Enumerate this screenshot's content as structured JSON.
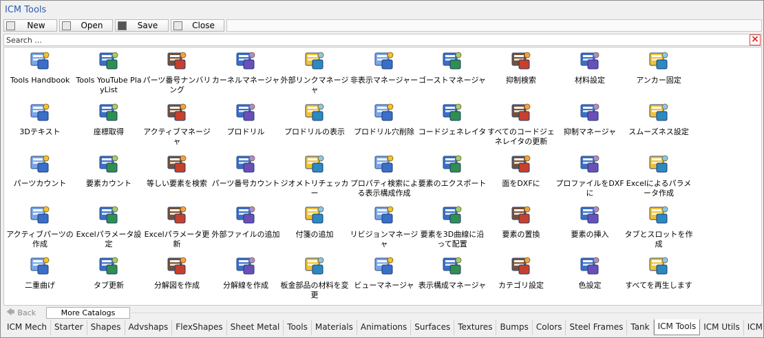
{
  "app": {
    "title": "ICM Tools"
  },
  "toolbar": {
    "new_label": "New",
    "open_label": "Open",
    "save_label": "Save",
    "close_label": "Close"
  },
  "search": {
    "placeholder": "Search ..."
  },
  "tools": [
    {
      "label": "Tools Handbook",
      "icon": "graduation-cap-icon"
    },
    {
      "label": "Tools YouTube PlayList",
      "icon": "video-playlist-icon"
    },
    {
      "label": "パーツ番号ナンバリング",
      "icon": "part-numbering-icon"
    },
    {
      "label": "カーネルマネージャ",
      "icon": "kernel-manager-icon"
    },
    {
      "label": "外部リンクマネージャ",
      "icon": "external-link-manager-icon"
    },
    {
      "label": "非表示マネージャー",
      "icon": "hide-manager-icon"
    },
    {
      "label": "ゴーストマネージャ",
      "icon": "ghost-manager-icon"
    },
    {
      "label": "抑制検索",
      "icon": "suppress-search-icon"
    },
    {
      "label": "材料設定",
      "icon": "material-setting-icon"
    },
    {
      "label": "アンカー固定",
      "icon": "anchor-fix-icon"
    },
    {
      "label": "3Dテキスト",
      "icon": "3d-text-icon"
    },
    {
      "label": "座標取得",
      "icon": "get-coordinates-icon"
    },
    {
      "label": "アクティブマネージャ",
      "icon": "active-manager-icon"
    },
    {
      "label": "プロドリル",
      "icon": "pro-drill-icon"
    },
    {
      "label": "プロドリルの表示",
      "icon": "pro-drill-show-icon"
    },
    {
      "label": "プロドリル穴削除",
      "icon": "pro-drill-delete-icon"
    },
    {
      "label": "コードジェネレイタ",
      "icon": "code-generator-icon"
    },
    {
      "label": "すべてのコードジェネレイタの更新",
      "icon": "code-generator-update-icon"
    },
    {
      "label": "抑制マネージャ",
      "icon": "suppress-manager-icon"
    },
    {
      "label": "スムーズネス設定",
      "icon": "smoothness-icon"
    },
    {
      "label": "パーツカウント",
      "icon": "parts-count-icon"
    },
    {
      "label": "要素カウント",
      "icon": "element-count-icon"
    },
    {
      "label": "等しい要素を検索",
      "icon": "find-equal-icon"
    },
    {
      "label": "パーツ番号カウント",
      "icon": "part-number-count-icon"
    },
    {
      "label": "ジオメトリチェッカー",
      "icon": "geometry-checker-icon"
    },
    {
      "label": "プロパティ検索による表示構成作成",
      "icon": "property-search-icon"
    },
    {
      "label": "要素のエクスポート",
      "icon": "element-export-icon"
    },
    {
      "label": "面をDXFに",
      "icon": "face-dxf-icon"
    },
    {
      "label": "プロファイルをDXFに",
      "icon": "profile-dxf-icon"
    },
    {
      "label": "Excelによるパラメータ作成",
      "icon": "excel-param-create-icon"
    },
    {
      "label": "アクティブパーツの作成",
      "icon": "active-parts-create-icon"
    },
    {
      "label": "Excelパラメータ設定",
      "icon": "excel-param-setting-icon"
    },
    {
      "label": "Excelパラメータ更新",
      "icon": "excel-param-update-icon"
    },
    {
      "label": "外部ファイルの追加",
      "icon": "attach-file-icon"
    },
    {
      "label": "付箋の追加",
      "icon": "sticky-note-icon"
    },
    {
      "label": "リビジョンマネージャ",
      "icon": "revision-manager-icon"
    },
    {
      "label": "要素を3D曲線に沿って配置",
      "icon": "place-along-curve-icon"
    },
    {
      "label": "要素の置換",
      "icon": "element-replace-icon"
    },
    {
      "label": "要素の挿入",
      "icon": "element-insert-icon"
    },
    {
      "label": "タブとスロットを作成",
      "icon": "tab-slot-icon"
    },
    {
      "label": "二重曲げ",
      "icon": "double-bend-icon"
    },
    {
      "label": "タブ更新",
      "icon": "tab-update-icon"
    },
    {
      "label": "分解図を作成",
      "icon": "exploded-view-icon"
    },
    {
      "label": "分解線を作成",
      "icon": "explode-line-icon"
    },
    {
      "label": "板金部品の材料を変更",
      "icon": "sheet-metal-material-icon"
    },
    {
      "label": "ビューマネージャ",
      "icon": "view-manager-icon"
    },
    {
      "label": "表示構成マネージャ",
      "icon": "display-config-manager-icon"
    },
    {
      "label": "カテゴリ設定",
      "icon": "category-setting-icon"
    },
    {
      "label": "色設定",
      "icon": "color-setting-icon"
    },
    {
      "label": "すべてを再生します",
      "icon": "regenerate-all-icon"
    }
  ],
  "nav": {
    "back_label": "Back",
    "more_label": "More Catalogs"
  },
  "tabs": [
    {
      "label": "ICM Mech"
    },
    {
      "label": "Starter"
    },
    {
      "label": "Shapes"
    },
    {
      "label": "Advshaps"
    },
    {
      "label": "FlexShapes"
    },
    {
      "label": "Sheet Metal"
    },
    {
      "label": "Tools"
    },
    {
      "label": "Materials"
    },
    {
      "label": "Animations"
    },
    {
      "label": "Surfaces"
    },
    {
      "label": "Textures"
    },
    {
      "label": "Bumps"
    },
    {
      "label": "Colors"
    },
    {
      "label": "Steel Frames"
    },
    {
      "label": "Tank"
    },
    {
      "label": "ICM Tools",
      "active": true
    },
    {
      "label": "ICM Utils"
    },
    {
      "label": "ICM Pipes"
    }
  ],
  "colors": {
    "title": "#2a5db0",
    "close": "#dd2222",
    "icon_blue": "#3a6fc8"
  }
}
